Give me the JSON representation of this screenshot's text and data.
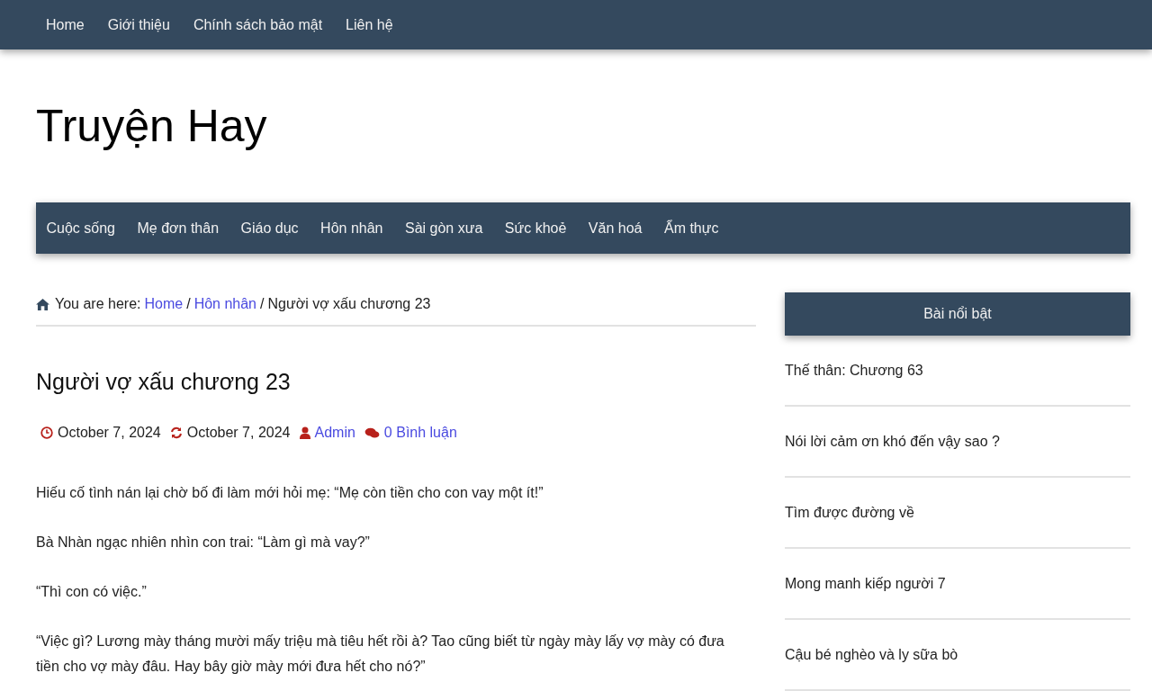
{
  "top_menu": [
    "Home",
    "Giới thiệu",
    "Chính sách bảo mật",
    "Liên hệ"
  ],
  "site_title": "Truyện Hay",
  "category_menu": [
    "Cuộc sống",
    "Mẹ đơn thân",
    "Giáo dục",
    "Hôn nhân",
    "Sài gòn xưa",
    "Sức khoẻ",
    "Văn hoá",
    "Ẩm thực"
  ],
  "breadcrumb": {
    "prefix": "You are here:",
    "links": [
      "Home",
      "Hôn nhân"
    ],
    "separator": "/",
    "current": "Người vợ xấu chương 23"
  },
  "post": {
    "title": "Người vợ xấu chương 23",
    "meta": [
      {
        "kind": "published",
        "text": "October 7, 2024"
      },
      {
        "kind": "updated",
        "text": "October 7, 2024"
      },
      {
        "kind": "author",
        "text": "Admin"
      },
      {
        "kind": "comments",
        "text": "0 Bình luận"
      }
    ],
    "paragraphs": [
      "Hiếu cố tình nán lại chờ bố đi làm mới hỏi mẹ: “Mẹ còn tiền cho con vay một ít!”",
      "Bà Nhàn ngạc nhiên nhìn con trai: “Làm gì mà vay?”",
      "“Thì con có việc.”",
      "“Việc gì? Lương mày tháng mười mấy triệu mà tiêu hết rồi à? Tao cũng biết từ ngày mày lấy vợ mày có đưa tiền cho vợ mày đâu. Hay bây giờ mày mới đưa hết cho nó?”"
    ]
  },
  "sidebar": {
    "title": "Bài nổi bật",
    "items": [
      "Thế thân: Chương 63",
      "Nói lời cảm ơn khó đến vậy sao ?",
      "Tìm được đường về",
      "Mong manh kiếp người 7",
      "Cậu bé nghèo và ly sữa bò"
    ]
  }
}
